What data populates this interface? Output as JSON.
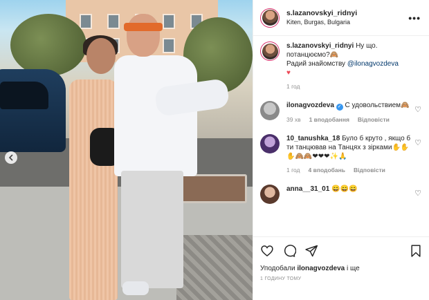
{
  "post": {
    "username": "s.lazanovskyi_ridnyi",
    "location": "Kiten, Burgas, Bulgaria",
    "more_icon": "more-horizontal-icon"
  },
  "caption": {
    "username": "s.lazanovskyi_ridnyi",
    "text_1": "Ну що. потанцюємо?🙈",
    "text_2": "Радий знайомству ",
    "mention": "@ilonagvozdeva",
    "heart": "♥",
    "time": "1 год"
  },
  "comments": [
    {
      "username": "ilonagvozdeva",
      "verified": true,
      "text": "С удовольствием🙈",
      "time": "39 хв",
      "likes": "1 вподобання",
      "reply": "Відповісти"
    },
    {
      "username": "10_tanushka_18",
      "verified": false,
      "text": "Було б круто , якщо б ти танцював на Танцях з зірками✋✋✋🙈🙈❤❤❤✨🙏",
      "time": "1 год",
      "likes": "4 вподобань",
      "reply": "Відповісти"
    },
    {
      "username": "anna__31_01",
      "verified": false,
      "text": "😄😄😄"
    }
  ],
  "actions": {
    "liked_prefix": "Уподобали ",
    "liked_user": "ilonagvozdeva",
    "liked_suffix": " і ще",
    "posted_time": "1 годину тому"
  },
  "colors": {
    "link": "#00376b",
    "meta": "#8e8e8e",
    "verified": "#3897f0",
    "story_ring": "#d82f6b"
  }
}
